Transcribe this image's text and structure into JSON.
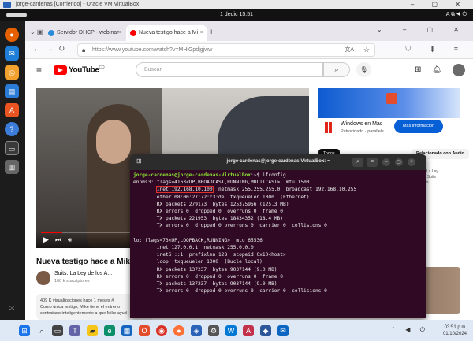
{
  "vm_window": {
    "title": "jorge-cardenas [Corriendo] - Oracle VM VirtualBox"
  },
  "ubuntu_topbar": {
    "clock": "1 dedic 15:51"
  },
  "browser": {
    "tabs": [
      {
        "label": "Servidor DHCP - webinar"
      },
      {
        "label": "Nueva testigo hace a Mi"
      }
    ],
    "url": "https://www.youtube.com/watch?v=MHiGpdjgjww"
  },
  "youtube": {
    "logo_text": "YouTube",
    "logo_country": "CO",
    "search_placeholder": "Buscar",
    "video_title": "Nueva testigo hace a Mike b",
    "channel_name": "Suits: La Ley de los A...",
    "channel_subs": "100 k suscriptores",
    "description": "409 K visualizaciones hace 1 meses #\nComo única testigo, Mike tiene el entreno\ncontratado inteligentemente a que Mike ayud",
    "ad_title": "Windows en Mac",
    "ad_subtitle": "Patrocinado · parallels",
    "ad_button": "Más información",
    "chip_all": "Todos",
    "chip_other": "Relacionado con Audio",
    "side_meta": "Suits: La Ley de los Suits Dorado"
  },
  "terminal": {
    "title": "jorge-cardenas@jorge-cardenas-VirtualBox: ~",
    "prompt_user": "jorge-cardenas@jorge-cardenas-VirtualBox",
    "prompt_path": ":~$ ifconfig",
    "lines": {
      "l1a": "enp0s3: ",
      "l1b": "flags=4163<UP,BROADCAST,RUNNING,MULTICAST>  mtu 1500",
      "l2a": "        ",
      "l2b": "inet 192.168.10.100",
      "l2c": "  netmask 255.255.255.0  broadcast 192.168.10.255",
      "l3": "        ether 08:00:27:72:c3:de  txqueuelen 1000  (Ethernet)",
      "l4": "        RX packets 279173  bytes 125375956 (125.3 MB)",
      "l5": "        RX errors 0  dropped 0  overruns 0  frame 0",
      "l6": "        TX packets 221953  bytes 18434352 (18.4 MB)",
      "l7": "        TX errors 0  dropped 0 overruns 0  carrier 0  collisions 0",
      "l8": "",
      "l9": "lo: flags=73<UP,LOOPBACK,RUNNING>  mtu 65536",
      "l10": "        inet 127.0.0.1  netmask 255.0.0.0",
      "l11": "        inet6 ::1  prefixlen 128  scopeid 0x10<host>",
      "l12": "        loop  txqueuelen 1000  (Bucle local)",
      "l13": "        RX packets 137237  bytes 9037144 (9.0 MB)",
      "l14": "        RX errors 0  dropped 0  overruns 0  frame 0",
      "l15": "        TX packets 137237  bytes 9037144 (9.0 MB)",
      "l16": "        TX errors 0  dropped 0 overruns 0  carrier 0  collisions 0"
    }
  },
  "windows_taskbar": {
    "time": "03:51 p.m.",
    "date": "01/10/2024"
  },
  "colors": {
    "yt_red": "#ff0000",
    "terminal_bg": "#300a24",
    "prompt_green": "#8ae234",
    "prompt_blue": "#729fcf",
    "highlight_red": "#e0312d"
  }
}
